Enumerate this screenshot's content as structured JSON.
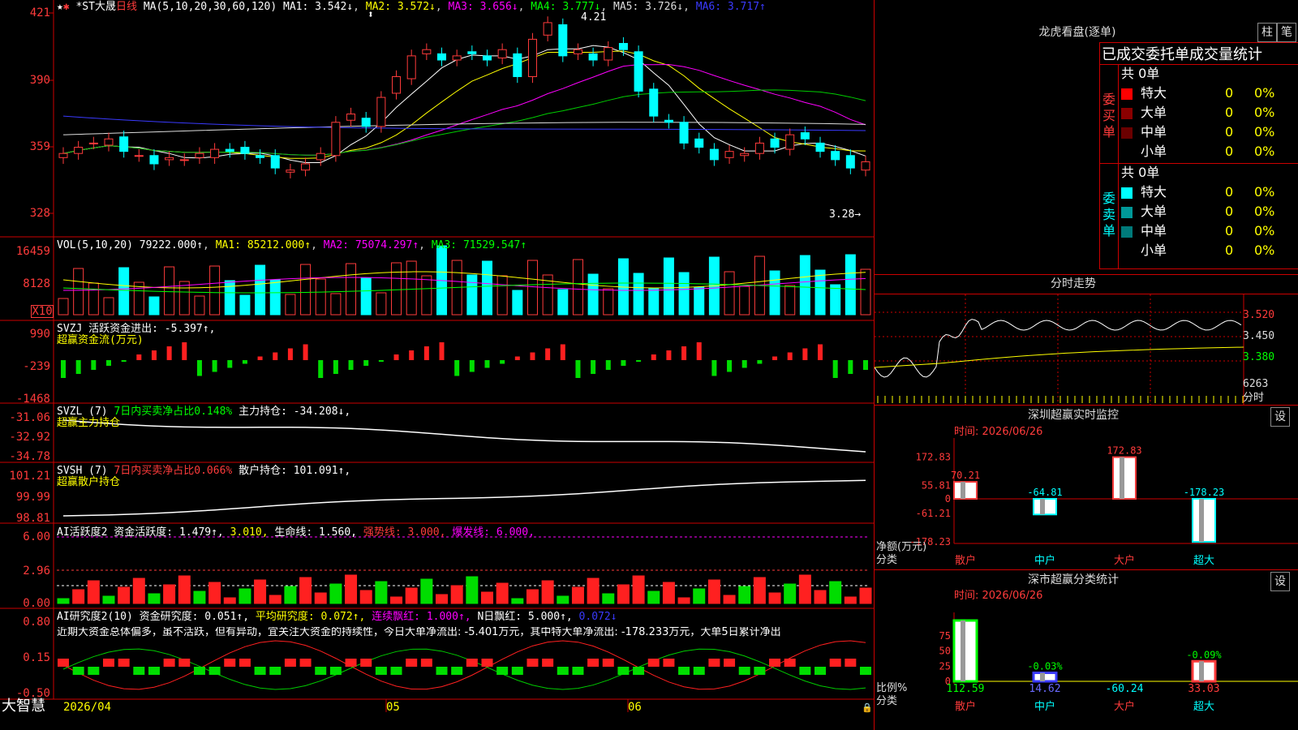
{
  "app": {
    "logo_text": "大智慧"
  },
  "main": {
    "header": {
      "stock": "*ST大晟",
      "period": "日线",
      "ma_label": "MA(5,10,20,30,60,120)",
      "ma1": "MA1: 3.542↓",
      "ma2": "MA2: 3.572↓",
      "ma3": "MA3: 3.656↓",
      "ma4": "MA4: 3.777↓",
      "ma5": "MA5: 3.726↓",
      "ma6": "MA6: 3.717↑",
      "high_label": "4.21",
      "low_label": "3.28→"
    },
    "yticks": [
      "421",
      "390",
      "359",
      "328"
    ],
    "vol": {
      "hdr": "VOL(5,10,20)",
      "v": "79222.000↑",
      "ma1": "MA1: 85212.000↑",
      "ma2": "MA2: 75074.297↑",
      "ma3": "MA3: 71529.547↑",
      "yticks": [
        "16459",
        "8128",
        "X10"
      ]
    },
    "svzj": {
      "hdr": "SVZJ  活跃资金进出: -5.397↑,",
      "sub": "超赢资金流(万元)",
      "yticks": [
        "990",
        "-239",
        "-1468"
      ]
    },
    "svzl": {
      "hdr": "SVZL (7) ",
      "p1": "7日内买卖净占比0.148%",
      "p2": " 主力持仓: -34.208↓,",
      "sub": "超赢主力持仓",
      "yticks": [
        "-31.06",
        "-32.92",
        "-34.78"
      ]
    },
    "svsh": {
      "hdr": "SVSH (7) ",
      "p1": "7日内买卖净占比0.066%",
      "p2": " 散户持仓: 101.091↑,",
      "sub": "超赢散户持仓",
      "yticks": [
        "101.21",
        "99.99",
        "98.81"
      ]
    },
    "ai1": {
      "hdr": "AI活跃度2 资金活跃度: 1.479↑, ",
      "p1": "3.010,",
      "p2": " 生命线: 1.560,",
      "p3": " 强势线: 3.000,",
      "p4": " 爆发线: 6.000,",
      "yticks": [
        "6.00",
        "2.96",
        "0.00"
      ]
    },
    "ai2": {
      "hdr": "AI研究度2(10) 资金研究度: 0.051↑,",
      "p1": " 平均研究度: 0.072↑,",
      "p2": " 连续飘红: 1.000↑,",
      "p3": " N日飘红: 5.000↑,",
      "p4": " 0.072↓",
      "comment": "近期大资金总体偏多，虽不活跃，但有异动，宜关注大资金的持续性，今日大单净流出: -5.401万元，其中特大单净流出: -178.233万元，大单5日累计净出",
      "yticks": [
        "0.80",
        "0.15",
        "-0.50"
      ]
    },
    "xaxis": [
      "2026/04",
      "05",
      "06"
    ]
  },
  "dragon": {
    "title": "龙虎看盘(逐单)",
    "btn1": "柱",
    "btn2": "笔",
    "table_title": "已成交委托单成交量统计",
    "buy": {
      "label": "委买单",
      "total": "共 0单",
      "rows": [
        {
          "name": "特大",
          "count": "0",
          "pct": "0%",
          "color": "#ff0000"
        },
        {
          "name": "大单",
          "count": "0",
          "pct": "0%",
          "color": "#8b0000"
        },
        {
          "name": "中单",
          "count": "0",
          "pct": "0%",
          "color": "#6b0000"
        },
        {
          "name": "小单",
          "count": "0",
          "pct": "0%",
          "color": "#000000"
        }
      ]
    },
    "sell": {
      "label": "委卖单",
      "total": "共 0单",
      "rows": [
        {
          "name": "特大",
          "count": "0",
          "pct": "0%",
          "color": "#00ffff"
        },
        {
          "name": "大单",
          "count": "0",
          "pct": "0%",
          "color": "#009999"
        },
        {
          "name": "中单",
          "count": "0",
          "pct": "0%",
          "color": "#007a7a"
        },
        {
          "name": "小单",
          "count": "0",
          "pct": "0%",
          "color": "#000000"
        }
      ]
    }
  },
  "intraday": {
    "title": "分时走势",
    "yticks": [
      "3.520",
      "3.450",
      "3.380"
    ],
    "vol_label": "6263",
    "sub": "分时"
  },
  "monitor": {
    "title": "深圳超赢实时监控",
    "btn": "设",
    "time": "时间: 2026/06/26",
    "yticks": [
      "172.83",
      "55.81",
      "0",
      "-61.21",
      "-178.23"
    ],
    "ylabel1": "净额(万元)",
    "ylabel2": "分类",
    "categories": [
      "散户",
      "中户",
      "大户",
      "超大"
    ],
    "values": [
      70.21,
      -64.81,
      172.83,
      -178.23
    ],
    "value_labels": [
      "70.21",
      "-64.81",
      "172.83",
      "-178.23"
    ]
  },
  "classify": {
    "title": "深市超赢分类统计",
    "btn": "设",
    "time": "时间: 2026/06/26",
    "yticks": [
      "75",
      "50",
      "25",
      "0"
    ],
    "ylabel1": "比例%",
    "ylabel2": "分类",
    "categories": [
      "散户",
      "中户",
      "大户",
      "超大"
    ],
    "pct_labels": [
      "",
      "-0.03%",
      "",
      "-0.09%"
    ],
    "bottom_labels": [
      "112.59",
      "14.62",
      "-60.24",
      "33.03"
    ],
    "heights": [
      100,
      14,
      0,
      33
    ]
  },
  "chart_data": [
    {
      "type": "bar",
      "title": "深圳超赢实时监控",
      "xlabel": "分类",
      "ylabel": "净额(万元)",
      "categories": [
        "散户",
        "中户",
        "大户",
        "超大"
      ],
      "values": [
        70.21,
        -64.81,
        172.83,
        -178.23
      ],
      "ylim": [
        -178.23,
        172.83
      ]
    },
    {
      "type": "bar",
      "title": "深市超赢分类统计",
      "xlabel": "分类",
      "ylabel": "比例%",
      "categories": [
        "散户",
        "中户",
        "大户",
        "超大"
      ],
      "values": [
        112.59,
        14.62,
        -60.24,
        33.03
      ],
      "ylim": [
        0,
        100
      ]
    },
    {
      "type": "line",
      "title": "*ST大晟 日线",
      "series": [
        {
          "name": "close (approx)",
          "values": [
            3.55,
            3.58,
            3.6,
            3.62,
            3.56,
            3.54,
            3.5,
            3.53,
            3.52,
            3.55,
            3.57,
            3.56,
            3.55,
            3.53,
            3.48,
            3.47,
            3.5,
            3.55,
            3.7,
            3.74,
            3.68,
            3.82,
            3.92,
            4.02,
            4.05,
            4.0,
            4.02,
            4.03,
            4.0,
            4.05,
            3.92,
            4.1,
            4.18,
            4.02,
            4.05,
            4.0,
            4.06,
            4.05,
            3.85,
            3.73,
            3.7,
            3.6,
            3.58,
            3.52,
            3.56,
            3.55,
            3.6,
            3.58,
            3.64,
            3.62,
            3.56,
            3.52,
            3.48,
            3.51
          ]
        }
      ]
    }
  ]
}
